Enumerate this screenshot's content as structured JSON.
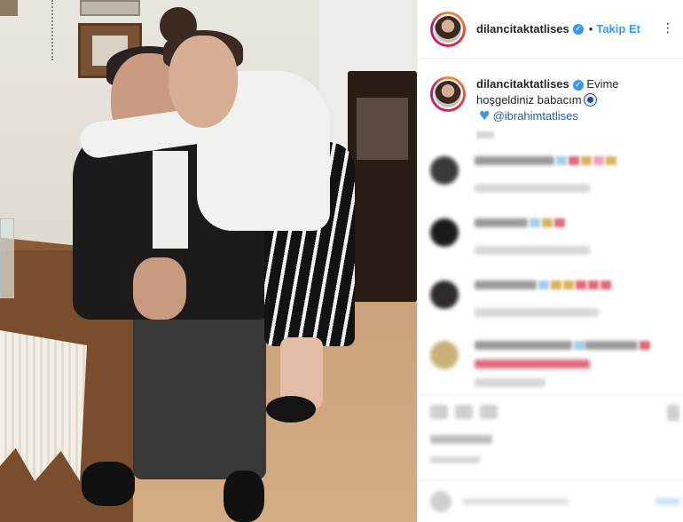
{
  "post": {
    "author": {
      "username": "dilancitaktatlises",
      "verified_icon": "verified-badge-icon",
      "separator": "•",
      "follow_label": "Takip Et",
      "more_icon": "more-options-icon"
    },
    "caption": {
      "username": "dilancitaktatlises",
      "text_1": "Evime hoşgeldiniz",
      "text_2": "babacım",
      "emojis": [
        "nazar-eye-icon",
        "blue-heart-icon"
      ],
      "mention": "@ibrahimtatlises"
    },
    "comments_count_visible": 4,
    "colors": {
      "follow": "#3897f0",
      "mention": "#1f5d9b",
      "verified": "#3897f0",
      "text": "#262626",
      "divider": "#efefef"
    }
  }
}
